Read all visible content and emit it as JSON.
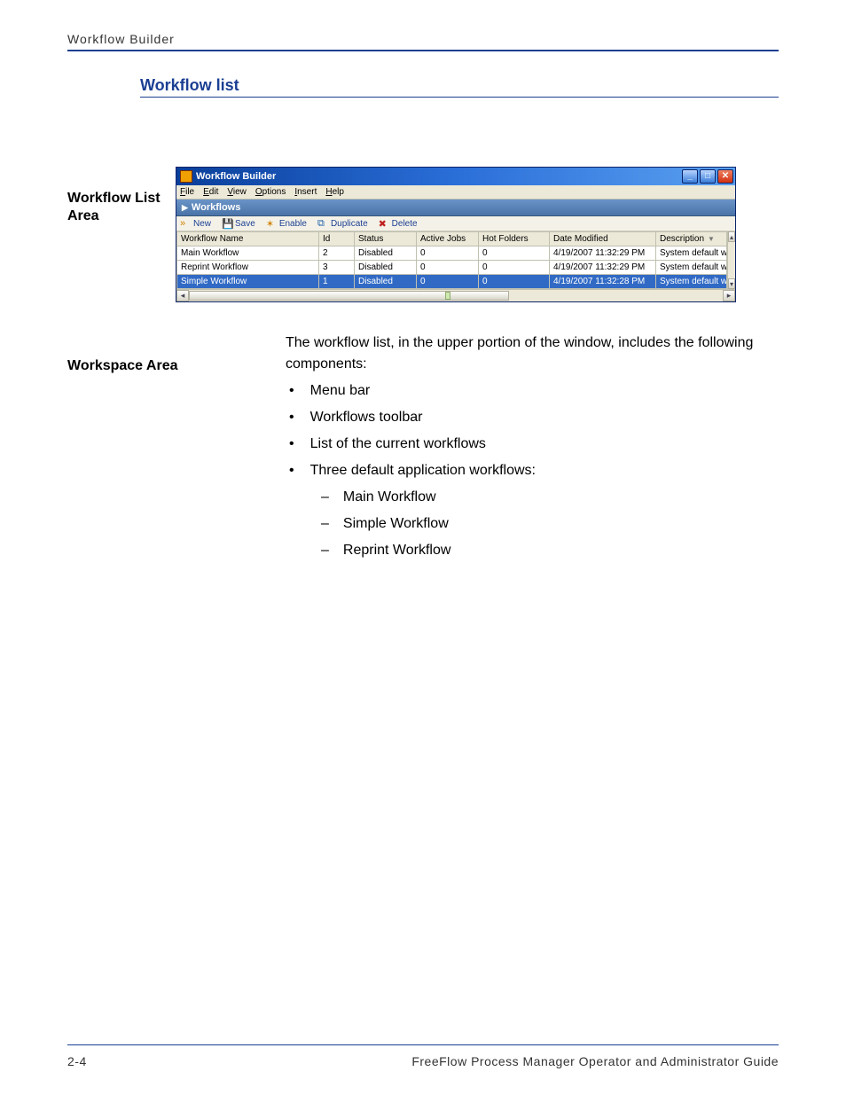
{
  "header": {
    "running_head": "Workflow Builder",
    "section_title": "Workflow list"
  },
  "side_labels": {
    "list_area": "Workflow List Area",
    "workspace_area": "Workspace Area"
  },
  "window": {
    "title": "Workflow Builder",
    "menu": {
      "file": "File",
      "edit": "Edit",
      "view": "View",
      "options": "Options",
      "insert": "Insert",
      "help": "Help"
    },
    "panel_header": "Workflows",
    "toolbar": {
      "new": "New",
      "save": "Save",
      "enable": "Enable",
      "duplicate": "Duplicate",
      "delete": "Delete"
    },
    "columns": {
      "name": "Workflow Name",
      "id": "Id",
      "status": "Status",
      "active_jobs": "Active Jobs",
      "hot_folders": "Hot Folders",
      "date_modified": "Date Modified",
      "description": "Description"
    },
    "rows": [
      {
        "name": "Main Workflow",
        "id": "2",
        "status": "Disabled",
        "active_jobs": "0",
        "hot_folders": "0",
        "date_modified": "4/19/2007 11:32:29 PM",
        "description": "System default workflo",
        "selected": false
      },
      {
        "name": "Reprint Workflow",
        "id": "3",
        "status": "Disabled",
        "active_jobs": "0",
        "hot_folders": "0",
        "date_modified": "4/19/2007 11:32:29 PM",
        "description": "System default workflo",
        "selected": false
      },
      {
        "name": "Simple Workflow",
        "id": "1",
        "status": "Disabled",
        "active_jobs": "0",
        "hot_folders": "0",
        "date_modified": "4/19/2007 11:32:28 PM",
        "description": "System default workflo",
        "selected": true
      }
    ]
  },
  "body": {
    "intro": "The workflow list, in the upper portion of the window, includes the following components:",
    "bullets": [
      "Menu bar",
      "Workflows toolbar",
      "List of the current workflows",
      "Three default application workflows:"
    ],
    "sub_bullets": [
      "Main Workflow",
      "Simple Workflow",
      "Reprint Workflow"
    ]
  },
  "footer": {
    "page_num": "2-4",
    "doc_title": "FreeFlow Process Manager Operator and Administrator Guide"
  }
}
